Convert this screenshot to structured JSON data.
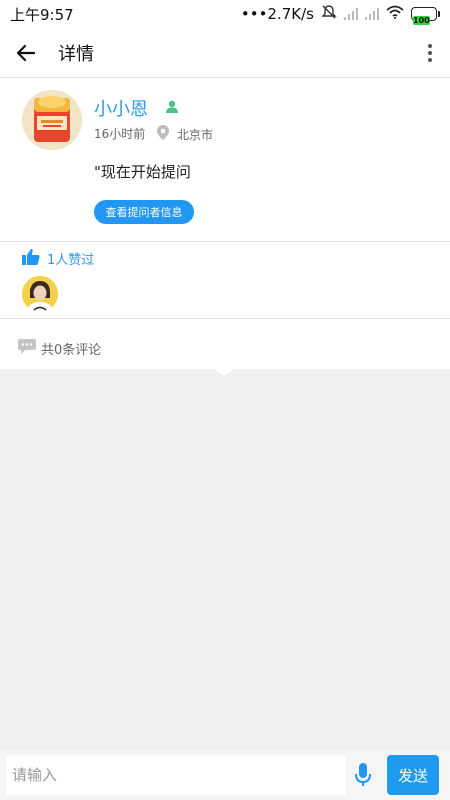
{
  "status_bar": {
    "time": "上午9:57",
    "network_speed": "•••2.7K/s",
    "battery_level": "100"
  },
  "nav": {
    "title": "详情",
    "back_icon": "arrow-left-icon",
    "more_icon": "more-vertical-icon"
  },
  "post": {
    "username": "小小恩",
    "time_ago": "16小时前",
    "location": "北京市",
    "content": "\"现在开始提问",
    "info_button_label": "查看提问者信息"
  },
  "likes": {
    "count_label": "1人赞过"
  },
  "comments": {
    "count_label": "共0条评论"
  },
  "input_bar": {
    "placeholder": "请输入",
    "send_label": "发送"
  },
  "colors": {
    "accent": "#2196f3",
    "link": "#2a9be8",
    "background_grey": "#efefef"
  }
}
